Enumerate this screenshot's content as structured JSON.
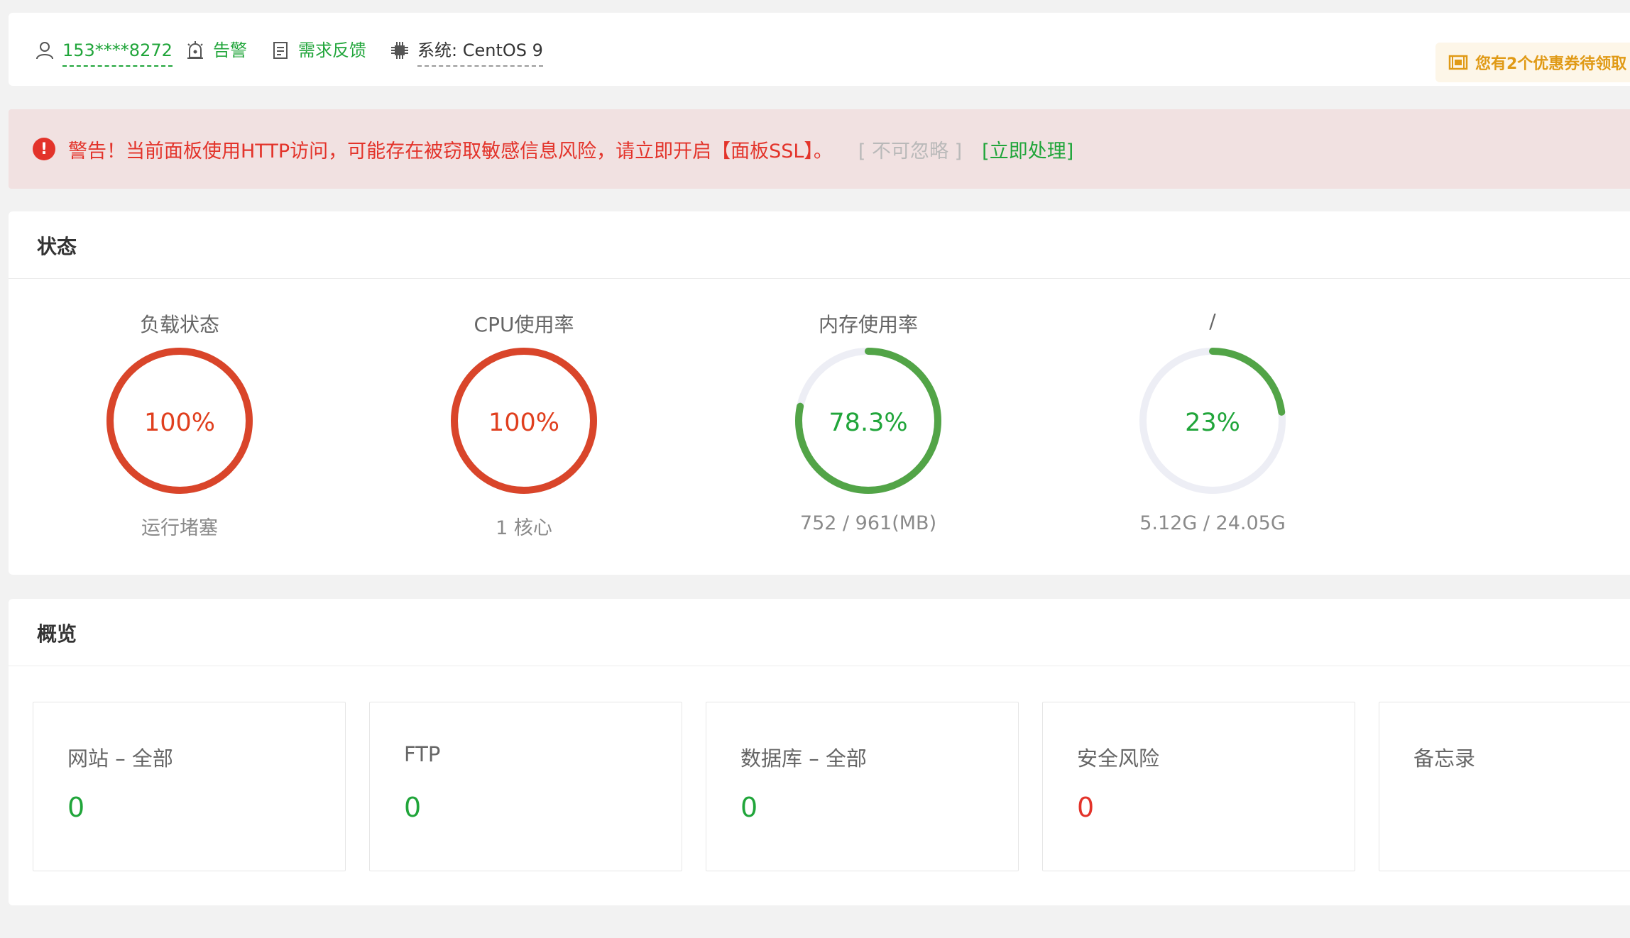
{
  "topbar": {
    "user": "153****8272",
    "alarm": "告警",
    "feedback": "需求反馈",
    "system_label": "系统:",
    "system_value": "CentOS 9",
    "coupon": "您有2个优惠券待领取"
  },
  "alert": {
    "message": "警告！当前面板使用HTTP访问，可能存在被窃取敏感信息风险，请立即开启【面板SSL】。",
    "ignore": "[ 不可忽略 ]",
    "handle": "[立即处理]"
  },
  "status": {
    "title": "状态",
    "gauges": [
      {
        "label": "负载状态",
        "value": "100%",
        "percent": 100,
        "sub": "运行堵塞",
        "color": "#d9452a"
      },
      {
        "label": "CPU使用率",
        "value": "100%",
        "percent": 100,
        "sub": "1 核心",
        "color": "#d9452a"
      },
      {
        "label": "内存使用率",
        "value": "78.3%",
        "percent": 78.3,
        "sub": "752 / 961(MB)",
        "color": "#52a447"
      },
      {
        "label": "/",
        "value": "23%",
        "percent": 23,
        "sub": "5.12G / 24.05G",
        "color": "#52a447"
      }
    ]
  },
  "overview": {
    "title": "概览",
    "cards": [
      {
        "title": "网站 – 全部",
        "value": "0"
      },
      {
        "title": "FTP",
        "value": "0"
      },
      {
        "title": "数据库 – 全部",
        "value": "0"
      },
      {
        "title": "安全风险",
        "value": "0"
      },
      {
        "title": "备忘录",
        "value": ""
      }
    ]
  },
  "colors": {
    "accent_green": "#20a53a",
    "danger_red": "#e3332a",
    "coupon_orange": "#e09a16"
  }
}
